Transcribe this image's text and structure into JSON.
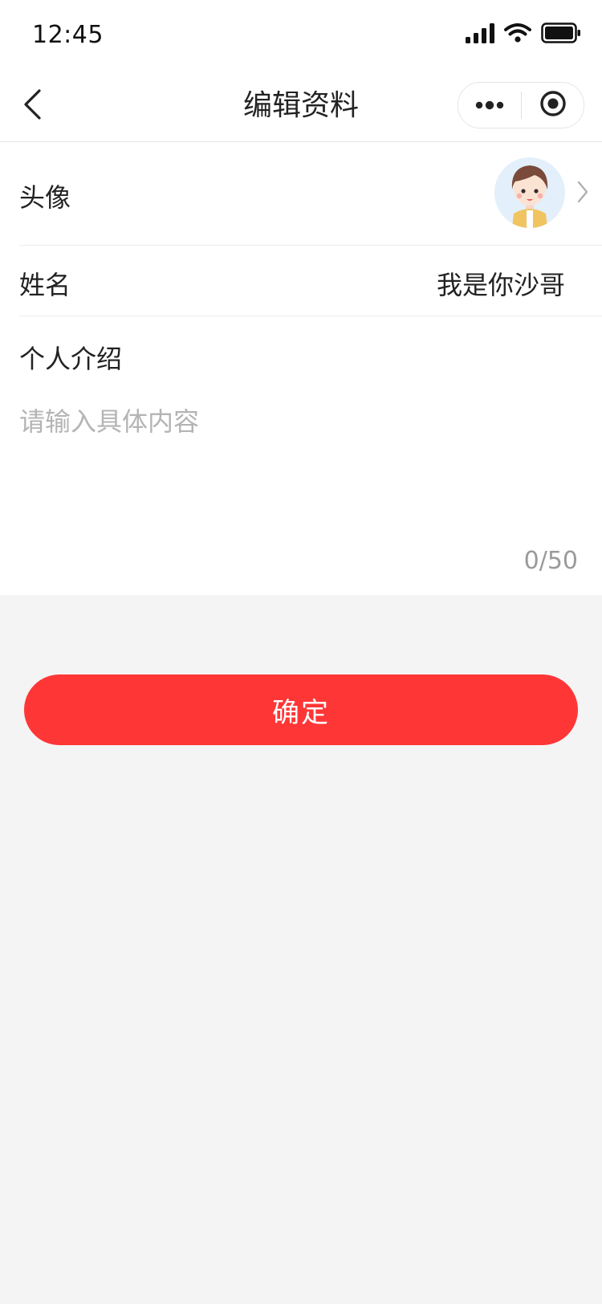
{
  "status_bar": {
    "time": "12:45",
    "icons": [
      "signal-icon",
      "wifi-icon",
      "battery-icon"
    ]
  },
  "nav": {
    "title": "编辑资料",
    "back_icon": "chevron-left-icon",
    "more_icon": "more-dots-icon",
    "close_icon": "mini-program-close-icon"
  },
  "form": {
    "avatar_label": "头像",
    "name_label": "姓名",
    "name_value": "我是你沙哥",
    "intro_label": "个人介绍",
    "intro_placeholder": "请输入具体内容",
    "intro_value": "",
    "intro_counter": "0/50"
  },
  "actions": {
    "confirm_label": "确定"
  },
  "colors": {
    "accent": "#ff3636",
    "page_background": "#f4f4f4",
    "placeholder": "#b4b4b4"
  }
}
